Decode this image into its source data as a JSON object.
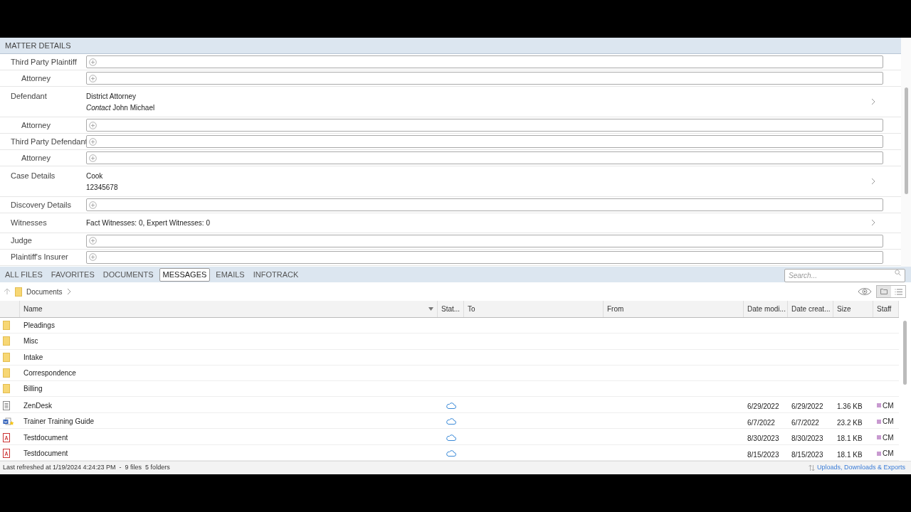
{
  "matter": {
    "title": "MATTER DETAILS",
    "rows": [
      {
        "label": "Third Party Plaintiff",
        "kind": "field",
        "children": [
          {
            "label": "Attorney",
            "kind": "field"
          }
        ]
      },
      {
        "label": "Defendant",
        "kind": "value",
        "lines": [
          "District Attorney",
          "*Contact* John Michael"
        ],
        "children": [
          {
            "label": "Attorney",
            "kind": "field"
          }
        ]
      },
      {
        "label": "Third Party Defendant",
        "kind": "field",
        "children": [
          {
            "label": "Attorney",
            "kind": "field"
          }
        ]
      },
      {
        "label": "Case Details",
        "kind": "value",
        "lines": [
          "Cook",
          "12345678"
        ]
      },
      {
        "label": "Discovery Details",
        "kind": "field"
      },
      {
        "label": "Witnesses",
        "kind": "value",
        "lines": [
          "Fact Witnesses: 0, Expert Witnesses: 0"
        ]
      },
      {
        "label": "Judge",
        "kind": "field"
      },
      {
        "label": "Plaintiff's Insurer",
        "kind": "field"
      }
    ]
  },
  "tabs": [
    {
      "label": "ALL FILES",
      "selected": false
    },
    {
      "label": "FAVORITES",
      "selected": false
    },
    {
      "label": "DOCUMENTS",
      "selected": false
    },
    {
      "label": "MESSAGES",
      "selected": true
    },
    {
      "label": "EMAILS",
      "selected": false
    },
    {
      "label": "INFOTRACK",
      "selected": false
    }
  ],
  "search": {
    "placeholder": "Search..."
  },
  "breadcrumb": [
    "Documents"
  ],
  "table": {
    "columns": [
      "Name",
      "Stat...",
      "To",
      "From",
      "Date modi...",
      "Date creat...",
      "Size",
      "Staff"
    ],
    "rows": [
      {
        "kind": "folder",
        "name": "Pleadings"
      },
      {
        "kind": "folder",
        "name": "Misc"
      },
      {
        "kind": "folder",
        "name": "Intake"
      },
      {
        "kind": "folder",
        "name": "Correspondence"
      },
      {
        "kind": "folder",
        "name": "Billing"
      },
      {
        "kind": "text",
        "name": "ZenDesk",
        "cloud": true,
        "modified": "6/29/2022",
        "created": "6/29/2022",
        "size": "1.36 KB",
        "staff": "CM",
        "color": "#c89ad0"
      },
      {
        "kind": "word",
        "name": "Trainer Training Guide",
        "cloud": true,
        "modified": "6/7/2022",
        "created": "6/7/2022",
        "size": "23.2 KB",
        "staff": "CM",
        "color": "#c89ad0"
      },
      {
        "kind": "pdf",
        "name": "Testdocument",
        "cloud": true,
        "modified": "8/30/2023",
        "created": "8/30/2023",
        "size": "18.1 KB",
        "staff": "CM",
        "color": "#c89ad0"
      },
      {
        "kind": "pdf",
        "name": "Testdocument",
        "cloud": true,
        "modified": "8/15/2023",
        "created": "8/15/2023",
        "size": "18.1 KB",
        "staff": "CM",
        "color": "#c89ad0"
      }
    ]
  },
  "status_bar": {
    "text": "Last refreshed at 1/19/2024 4:24:23 PM  -  9 files  5 folders",
    "link": "Uploads, Downloads & Exports"
  }
}
